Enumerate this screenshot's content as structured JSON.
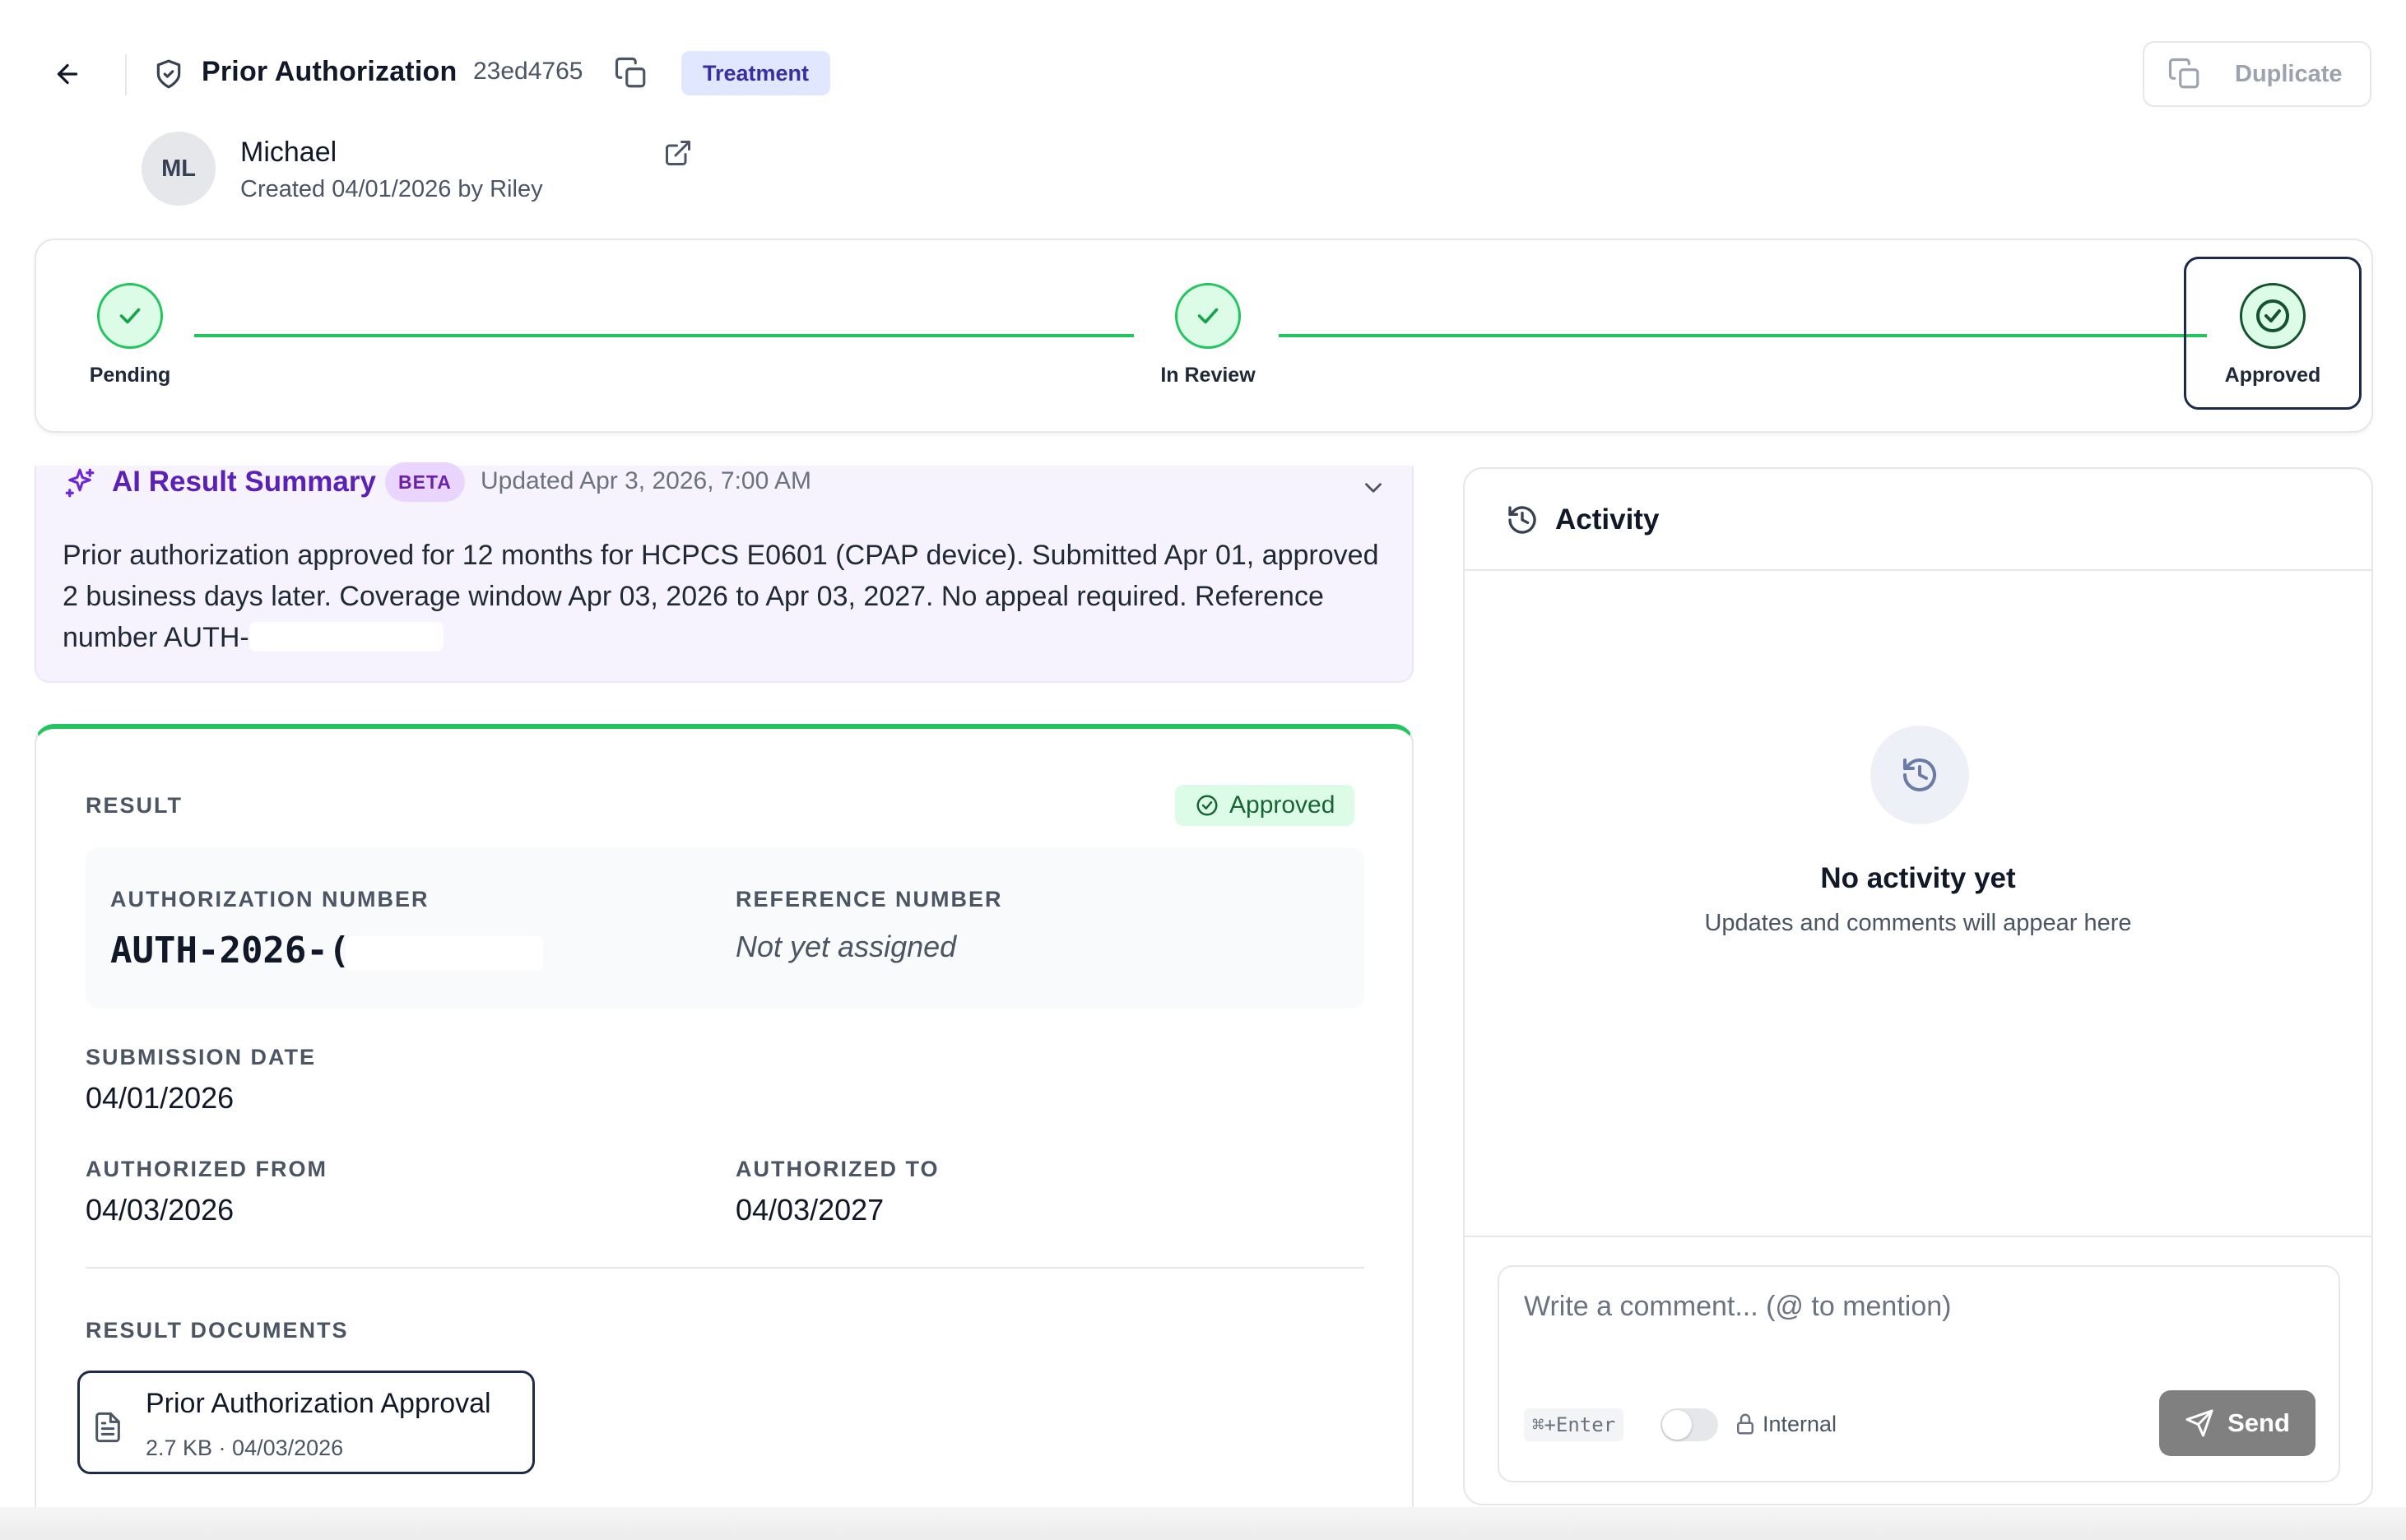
{
  "header": {
    "title": "Prior Authorization",
    "case_id": "23ed4765",
    "tag": "Treatment",
    "duplicate_label": "Duplicate"
  },
  "patient": {
    "initials": "ML",
    "name": "Michael",
    "created": "Created 04/01/2026 by Riley"
  },
  "stepper": {
    "steps": [
      {
        "label": "Pending",
        "state": "complete"
      },
      {
        "label": "In Review",
        "state": "complete"
      },
      {
        "label": "Approved",
        "state": "current"
      }
    ]
  },
  "ai_summary": {
    "title": "AI Result Summary",
    "badge": "BETA",
    "updated": "Updated Apr 3, 2026, 7:00 AM",
    "body": "Prior authorization approved for 12 months for HCPCS E0601 (CPAP device). Submitted Apr 01, approved 2 business days later. Coverage window Apr 03, 2026 to Apr 03, 2027. No appeal required. Reference number AUTH-"
  },
  "result": {
    "section_label": "RESULT",
    "status": "Approved",
    "authorization_number_label": "AUTHORIZATION NUMBER",
    "authorization_number": "AUTH-2026-(",
    "reference_number_label": "REFERENCE NUMBER",
    "reference_number": "Not yet assigned",
    "submission_date_label": "SUBMISSION DATE",
    "submission_date": "04/01/2026",
    "authorized_from_label": "AUTHORIZED FROM",
    "authorized_from": "04/03/2026",
    "authorized_to_label": "AUTHORIZED TO",
    "authorized_to": "04/03/2027",
    "documents_label": "RESULT DOCUMENTS",
    "documents": [
      {
        "name": "Prior Authorization Approval",
        "meta": "2.7 KB · 04/03/2026"
      }
    ]
  },
  "activity": {
    "title": "Activity",
    "empty_title": "No activity yet",
    "empty_subtitle": "Updates and comments will appear here",
    "comment_placeholder": "Write a comment... (@ to mention)",
    "shortcut": "⌘+Enter",
    "internal_label": "Internal",
    "internal_enabled": false,
    "send_label": "Send"
  },
  "colors": {
    "success": "#22c55e",
    "ai_accent": "#5b21b6",
    "tag_bg": "#e0e7ff",
    "active_border": "#1e2a4a"
  }
}
